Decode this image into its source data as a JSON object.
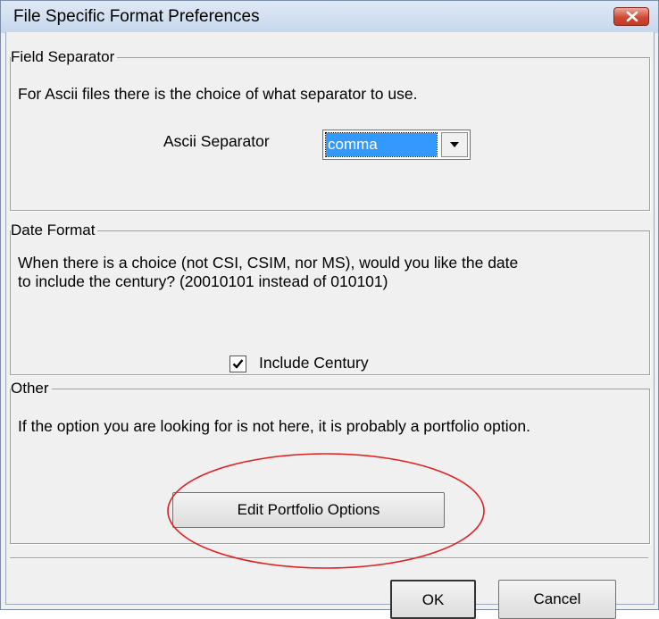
{
  "window": {
    "title": "File Specific Format Preferences"
  },
  "field_separator": {
    "legend": "Field Separator",
    "description": "For Ascii files there is the choice of what separator to use.",
    "label": "Ascii Separator",
    "selected": "comma"
  },
  "date_format": {
    "legend": "Date Format",
    "description_line1": "When there is a choice (not CSI, CSIM, nor MS), would you like the date",
    "description_line2": "to include the century? (20010101 instead of 010101)",
    "checkbox_label": "Include Century",
    "checked": true
  },
  "other": {
    "legend": "Other",
    "description": "If the option you are looking for is not here, it is probably a portfolio option.",
    "button_label": "Edit Portfolio Options"
  },
  "buttons": {
    "ok": "OK",
    "cancel": "Cancel"
  },
  "colors": {
    "highlight": "#e02020",
    "selection": "#3399ff"
  }
}
